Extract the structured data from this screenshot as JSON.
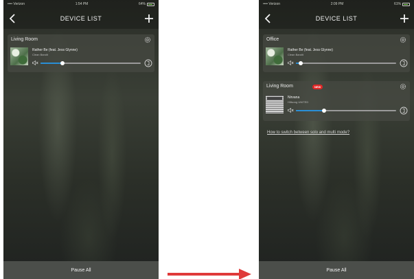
{
  "colors": {
    "accent": "#2a8fd6",
    "badge": "#e02828",
    "arrow": "#e03a3a"
  },
  "icons": {
    "back": "chevron-left-icon",
    "add": "plus-icon",
    "settings": "gear-icon",
    "volume": "speaker-icon",
    "info": "circle-info-icon",
    "transition": "arrow-right-icon"
  },
  "left_screen": {
    "status": {
      "carrier": "•••• Verizon",
      "time": "1:54 PM",
      "battery": "64%"
    },
    "nav": {
      "title": "DEVICE LIST"
    },
    "rooms": [
      {
        "name": "Living Room",
        "track": "Rather Be (feat. Jess Glynne)",
        "artist": "Clean Bandit",
        "volume_fraction": 0.22
      }
    ],
    "bottom": {
      "label": "Pause All"
    }
  },
  "right_screen": {
    "status": {
      "carrier": "•••• Verizon",
      "time": "2:09 PM",
      "battery": "61%"
    },
    "nav": {
      "title": "DEVICE LIST"
    },
    "rooms": [
      {
        "name": "Office",
        "track": "Rather Be (feat. Jess Glynne)",
        "artist": "Clean Bandit",
        "volume_fraction": 0.05
      },
      {
        "name": "Living Room",
        "badge": "NEW",
        "track": "Nirvana",
        "artist": "Hillsong UNITED",
        "volume_fraction": 0.28
      }
    ],
    "help_link": "How to switch between solo and multi mode?",
    "bottom": {
      "label": "Pause All"
    }
  }
}
